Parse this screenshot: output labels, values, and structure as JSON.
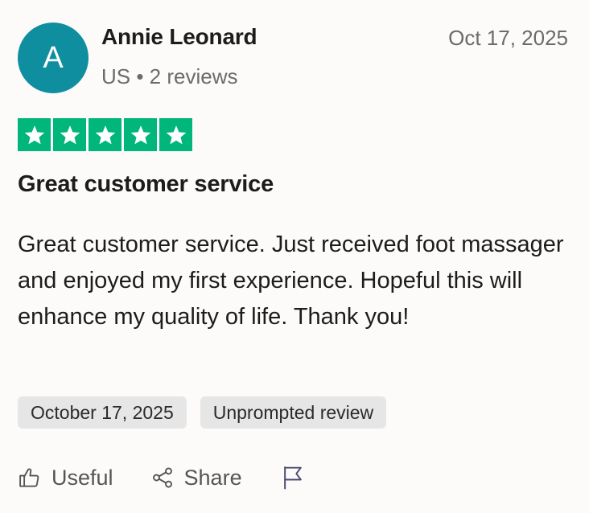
{
  "reviewer": {
    "initial": "A",
    "name": "Annie Leonard",
    "meta": "US • 2 reviews",
    "avatar_color": "#0f8ea0"
  },
  "review": {
    "date_top": "Oct 17, 2025",
    "rating": 5,
    "rating_color": "#00b67a",
    "title": "Great customer service",
    "body": "Great customer service. Just received foot massager and enjoyed my first experience. Hopeful this will enhance my quality of life. Thank you!",
    "chips": {
      "date": "October 17, 2025",
      "type": "Unprompted review"
    }
  },
  "actions": {
    "useful_label": "Useful",
    "useful_icon": "thumbs-up-icon",
    "share_label": "Share",
    "share_icon": "share-icon",
    "flag_icon": "flag-icon"
  }
}
